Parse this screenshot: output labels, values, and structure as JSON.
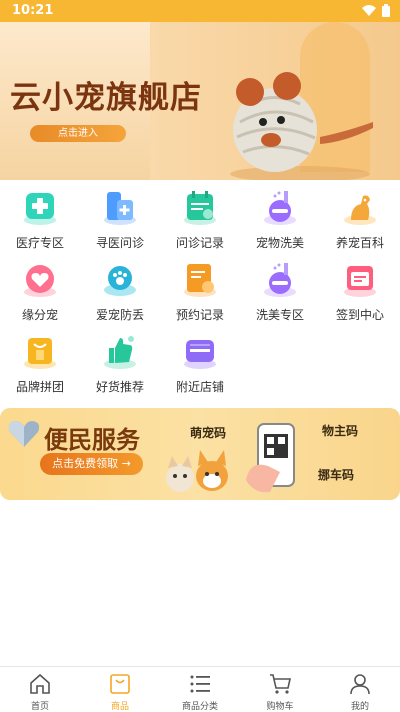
{
  "status_bar": {
    "time": "10:21"
  },
  "banner": {
    "title": "云小宠旗舰店",
    "enter_button": "点击进入",
    "dots": 5,
    "active_dot": 1
  },
  "menu": [
    {
      "label": "医疗专区",
      "icon": "medical-kit-icon"
    },
    {
      "label": "寻医问诊",
      "icon": "medicine-icon"
    },
    {
      "label": "问诊记录",
      "icon": "calendar-record-icon"
    },
    {
      "label": "宠物洗美",
      "icon": "shower-icon"
    },
    {
      "label": "养宠百科",
      "icon": "dog-icon"
    },
    {
      "label": "缘分宠",
      "icon": "heart-icon"
    },
    {
      "label": "爱宠防丢",
      "icon": "paw-location-icon"
    },
    {
      "label": "预约记录",
      "icon": "appointment-icon"
    },
    {
      "label": "洗美专区",
      "icon": "shower-icon"
    },
    {
      "label": "签到中心",
      "icon": "calendar-checkin-icon"
    },
    {
      "label": "品牌拼团",
      "icon": "shopping-bag-icon"
    },
    {
      "label": "好货推荐",
      "icon": "thumbs-up-icon"
    },
    {
      "label": "附近店铺",
      "icon": "store-icon"
    }
  ],
  "service": {
    "title": "便民服务",
    "claim_button": "点击免费领取 →",
    "tag_pet_code": "萌宠码",
    "tag_owner_code": "物主码",
    "tag_car_code": "挪车码"
  },
  "tabbar": [
    {
      "label": "首页",
      "icon": "home-icon"
    },
    {
      "label": "商品",
      "icon": "bag-icon"
    },
    {
      "label": "商品分类",
      "icon": "list-icon"
    },
    {
      "label": "购物车",
      "icon": "cart-icon"
    },
    {
      "label": "我的",
      "icon": "user-icon"
    }
  ],
  "active_tab": 1,
  "colors": {
    "accent": "#f5a623",
    "status_bar": "#f7b733",
    "title_brown": "#7a3410"
  }
}
